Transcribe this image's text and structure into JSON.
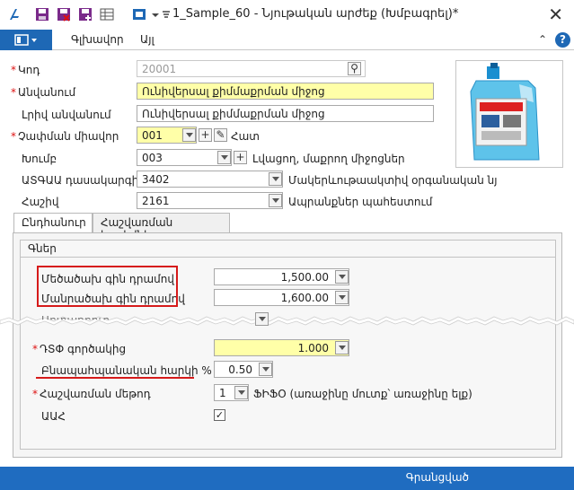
{
  "window": {
    "title": "1_Sample_60 - Նյութական արժեք (Խմբագրել)*",
    "close_glyph": "✕"
  },
  "menu": {
    "items": [
      "Գլխավոր",
      "Այլ"
    ],
    "help": "?",
    "collapse": "⌃"
  },
  "form": {
    "code": {
      "label": "Կոդ",
      "value": "20001"
    },
    "name": {
      "label": "Անվանում",
      "value": "Ունիվերսալ քիմմաքրման միջոց"
    },
    "full_name": {
      "label": "Լրիվ անվանում",
      "value": "Ունիվերսալ քիմմաքրման միջոց"
    },
    "unit": {
      "label": "Չափման միավոր",
      "value": "001",
      "text": "Հատ"
    },
    "group": {
      "label": "Խումբ",
      "value": "003",
      "text": "Լվացող, մաքրող միջոցներ"
    },
    "atgaa": {
      "label": "ԱՏԳԱԱ դասակարգիչ",
      "value": "3402",
      "text": "Մակերևութաակտիվ օրգանական նյ"
    },
    "account": {
      "label": "Հաշիվ",
      "value": "2161",
      "text": "Ապրանքներ պահեստում"
    }
  },
  "tabs": [
    "Ընդհանուր",
    "Հաշվառման հաշիվներ"
  ],
  "prices": {
    "group_title": "Գներ",
    "wholesale": {
      "label": "Մեծածախ գին դրամով",
      "value": "1,500.00"
    },
    "retail": {
      "label": "Մանրածախ գին դրամով",
      "value": "1,600.00"
    },
    "partial_label": "Արտադրուդ",
    "vat_coef": {
      "label": "ԴՏՓ գործակից",
      "value": "1.000"
    },
    "natural_loss": {
      "label": "Բնապահպանական հարկի %",
      "value": "0.50"
    },
    "method": {
      "label": "Հաշվառման մեթոդ",
      "value": "1",
      "text": "ՖԻՖՕ (առաջինը մուտք՝ առաջինը ելք)"
    },
    "vat": {
      "label": "ԱԱՀ",
      "checked": "✓"
    }
  },
  "statusbar": {
    "text": "Գրանցված"
  },
  "colors": {
    "accent": "#1e68b5",
    "highlight": "#d61a1a",
    "required_bg": "#ffffa8"
  }
}
